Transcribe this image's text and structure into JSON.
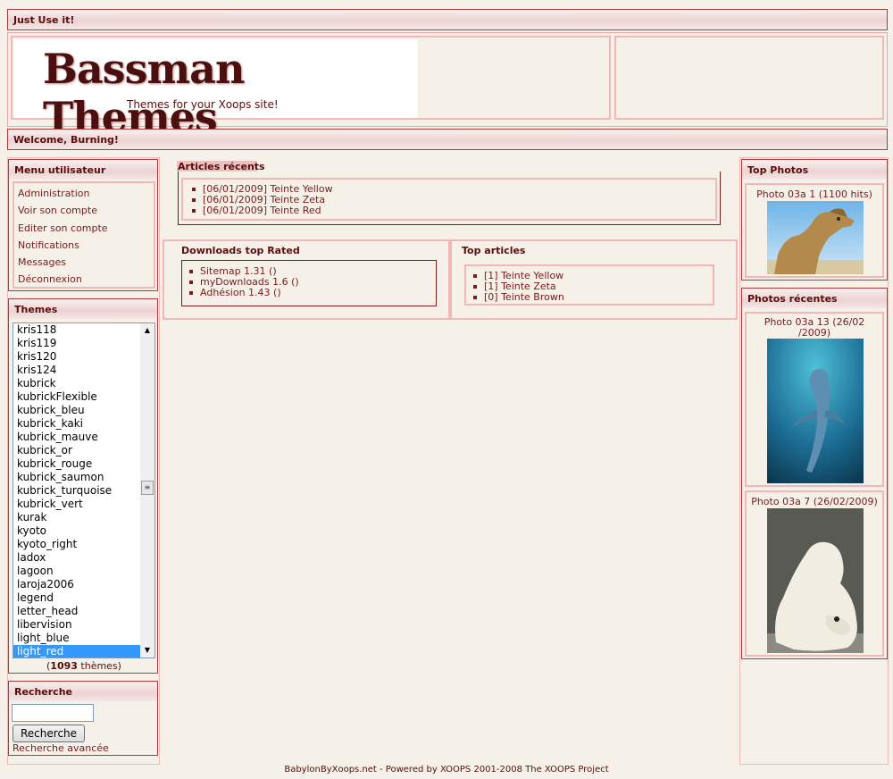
{
  "top_bar": {
    "title": "Just Use it!"
  },
  "logo": {
    "title": "Bassman Themes",
    "tagline": "Themes for your Xoops site!"
  },
  "welcome_bar": {
    "text": "Welcome, Burning!"
  },
  "user_menu": {
    "title": "Menu utilisateur",
    "items": [
      "Administration",
      "Voir son compte",
      "Editer son compte",
      "Notifications",
      "Messages",
      "Déconnexion"
    ]
  },
  "themes": {
    "title": "Themes",
    "options": [
      "kris118",
      "kris119",
      "kris120",
      "kris124",
      "kubrick",
      "kubrickFlexible",
      "kubrick_bleu",
      "kubrick_kaki",
      "kubrick_mauve",
      "kubrick_or",
      "kubrick_rouge",
      "kubrick_saumon",
      "kubrick_turquoise",
      "kubrick_vert",
      "kurak",
      "kyoto",
      "kyoto_right",
      "ladox",
      "lagoon",
      "laroja2006",
      "legend",
      "letter_head",
      "libervision",
      "light_blue",
      "light_red"
    ],
    "selected": "light_red",
    "count_prefix": "(",
    "count": "1093",
    "count_suffix": " thèmes)"
  },
  "search": {
    "title": "Recherche",
    "value": "",
    "button_label": "Recherche",
    "advanced_link": "Recherche avancée"
  },
  "recent_articles": {
    "title": "Articles récents",
    "items": [
      "[06/01/2009] Teinte Yellow",
      "[06/01/2009] Teinte Zeta",
      "[06/01/2009] Teinte Red"
    ]
  },
  "downloads_top": {
    "title": "Downloads top Rated",
    "items": [
      "Sitemap 1.31 ()",
      "myDownloads 1.6 ()",
      "Adhésion 1.43 ()"
    ]
  },
  "top_articles": {
    "title": "Top articles",
    "items": [
      "[1] Teinte Yellow",
      "[1] Teinte Zeta",
      "[0] Teinte Brown"
    ]
  },
  "top_photos": {
    "title": "Top Photos",
    "items": [
      {
        "caption": "Photo 03a 1 (1100 hits)",
        "image": "camel-photo"
      }
    ]
  },
  "recent_photos": {
    "title": "Photos récentes",
    "items": [
      {
        "caption_line1": "Photo 03a 13 (26/02",
        "caption_line2": "/2009)",
        "image": "dolphin-photo"
      },
      {
        "caption": "Photo 03a 7 (26/02/2009)",
        "image": "polar-bear-photo"
      }
    ]
  },
  "footer": {
    "text": "BabylonByXoops.net - Powered by XOOPS 2001-2008 The XOOPS Project"
  },
  "colors": {
    "background": "#f5f0e8",
    "accent": "#7a1a1a",
    "border": "#f2b8b8",
    "selection": "#3399ff"
  }
}
